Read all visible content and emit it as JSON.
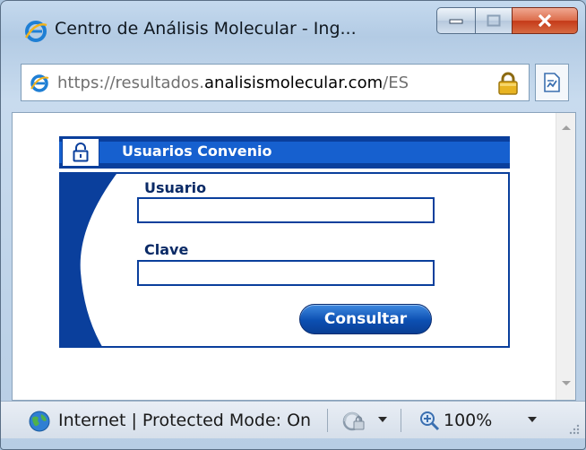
{
  "window": {
    "title": "Centro de Análisis Molecular - Ing...",
    "icon": "ie-icon",
    "controls": [
      "minimize-icon",
      "maximize-icon",
      "close-icon"
    ]
  },
  "address_bar": {
    "url_scheme": "https://",
    "url_subdomain": "resultados.",
    "url_domain": "analisismolecular.com",
    "url_path": "/ES",
    "secure_icon": "padlock-icon",
    "compat_icon": "compatibility-view-icon"
  },
  "login": {
    "header_title": "Usuarios Convenio",
    "header_icon": "padlock-icon",
    "user_label": "Usuario",
    "user_value": "",
    "password_label": "Clave",
    "password_value": "",
    "submit_label": "Consultar",
    "colors": {
      "primary": "#0a3f9c",
      "stripe": "#1660cf"
    }
  },
  "status_bar": {
    "zone_text": "Internet | Protected Mode: On",
    "zone_icon": "globe-icon",
    "protected_icon": "protected-mode-icon",
    "zoom_text": "100%",
    "zoom_icon": "zoom-icon"
  }
}
